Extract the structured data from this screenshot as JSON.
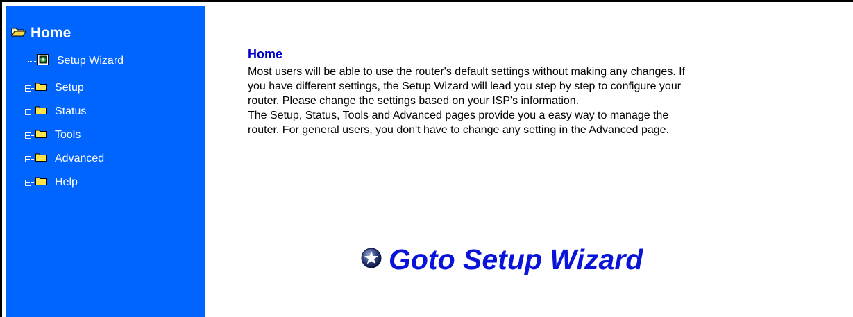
{
  "sidebar": {
    "home_label": "Home",
    "items": [
      {
        "label": "Setup Wizard",
        "type": "page"
      },
      {
        "label": "Setup",
        "type": "folder"
      },
      {
        "label": "Status",
        "type": "folder"
      },
      {
        "label": "Tools",
        "type": "folder"
      },
      {
        "label": "Advanced",
        "type": "folder"
      },
      {
        "label": "Help",
        "type": "folder"
      }
    ],
    "background_color": "#0064ff"
  },
  "main": {
    "title": "Home",
    "paragraph_lines": [
      "Most users will be able to use the router's default settings without making any changes. If",
      "you have different settings, the Setup Wizard will lead you step by step to configure your",
      "router. Please change the settings based on your ISP's information.",
      "The Setup, Status, Tools and Advanced pages provide you a easy way to manage the",
      "router. For general users, you don't have to change any setting in the Advanced page."
    ],
    "wizard_link_label": "Goto Setup Wizard",
    "title_color": "#0000cc",
    "link_color": "#0a14d8"
  }
}
